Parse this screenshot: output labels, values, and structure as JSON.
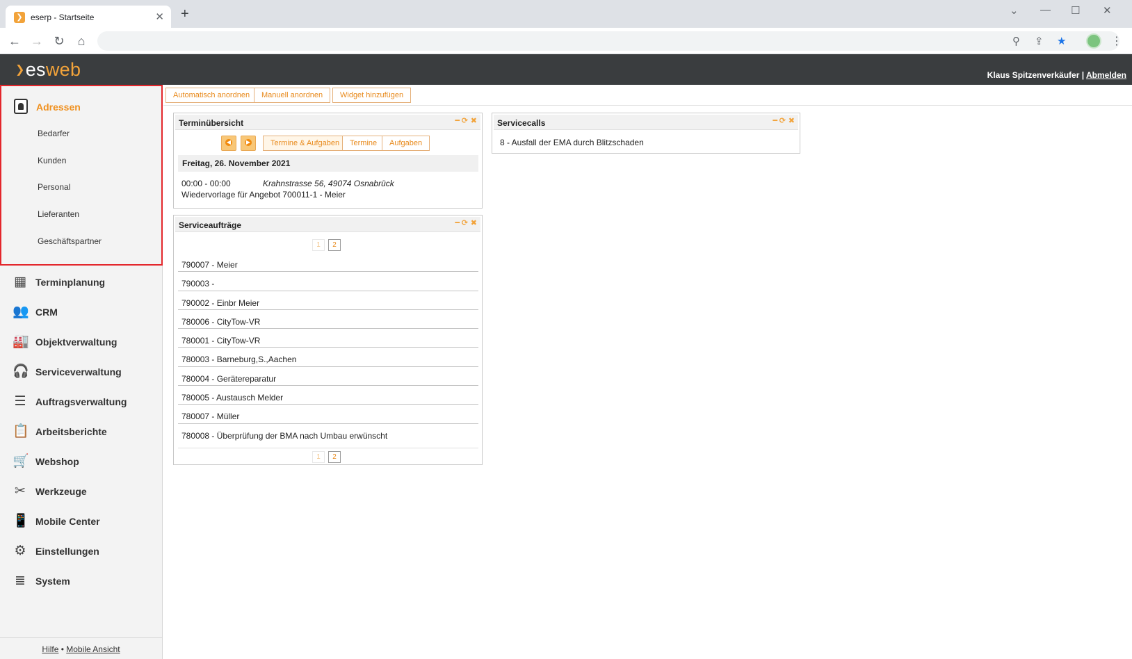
{
  "browser": {
    "tab_title": "eserp - Startseite",
    "tab_close": "✕",
    "new_tab": "+"
  },
  "header": {
    "logo_es": "es",
    "logo_web": "web",
    "user_name": "Klaus Spitzenverkäufer",
    "separator": "|",
    "logout": "Abmelden"
  },
  "sidebar": {
    "active_section": "Adressen",
    "sub_items": [
      "Bedarfer",
      "Kunden",
      "Personal",
      "Lieferanten",
      "Geschäftspartner"
    ],
    "items": [
      {
        "label": "Terminplanung",
        "icon": "calendar-icon"
      },
      {
        "label": "CRM",
        "icon": "users-icon"
      },
      {
        "label": "Objektverwaltung",
        "icon": "factory-icon"
      },
      {
        "label": "Serviceverwaltung",
        "icon": "headset-icon"
      },
      {
        "label": "Auftragsverwaltung",
        "icon": "list-icon"
      },
      {
        "label": "Arbeitsberichte",
        "icon": "clipboard-icon"
      },
      {
        "label": "Webshop",
        "icon": "cart-icon"
      },
      {
        "label": "Werkzeuge",
        "icon": "tools-icon"
      },
      {
        "label": "Mobile Center",
        "icon": "mobile-icon"
      },
      {
        "label": "Einstellungen",
        "icon": "gears-icon"
      },
      {
        "label": "System",
        "icon": "database-icon"
      }
    ],
    "footer": {
      "help": "Hilfe",
      "dot": "•",
      "mobile": "Mobile Ansicht"
    }
  },
  "toolbar": {
    "auto_arrange": "Automatisch anordnen",
    "manual_arrange": "Manuell anordnen",
    "add_widget": "Widget hinzufügen"
  },
  "termin": {
    "title": "Terminübersicht",
    "tabs": [
      "Termine & Aufgaben",
      "Termine",
      "Aufgaben"
    ],
    "date": "Freitag, 26. November 2021",
    "time": "00:00 - 00:00",
    "place": "Krahnstrasse 56, 49074 Osnabrück",
    "description": "Wiedervorlage für Angebot 700011-1 - Meier"
  },
  "serviceauftraege": {
    "title": "Serviceaufträge",
    "pages": [
      "1",
      "2"
    ],
    "rows": [
      "790007 - Meier",
      "790003 -",
      "790002 - Einbr Meier",
      "780006 - CityTow-VR",
      "780001 - CityTow-VR",
      "780003 - Barneburg,S.,Aachen",
      "780004 - Gerätereparatur",
      "780005 - Austausch Melder",
      "780007 - Müller",
      "780008 - Überprüfung der BMA nach Umbau erwünscht"
    ]
  },
  "servicecalls": {
    "title": "Servicecalls",
    "item": "8 - Ausfall der EMA durch Blitzschaden"
  },
  "colors": {
    "accent": "#f2a33a",
    "header_bg": "#3a3d3f",
    "highlight_border": "#e3262b"
  }
}
